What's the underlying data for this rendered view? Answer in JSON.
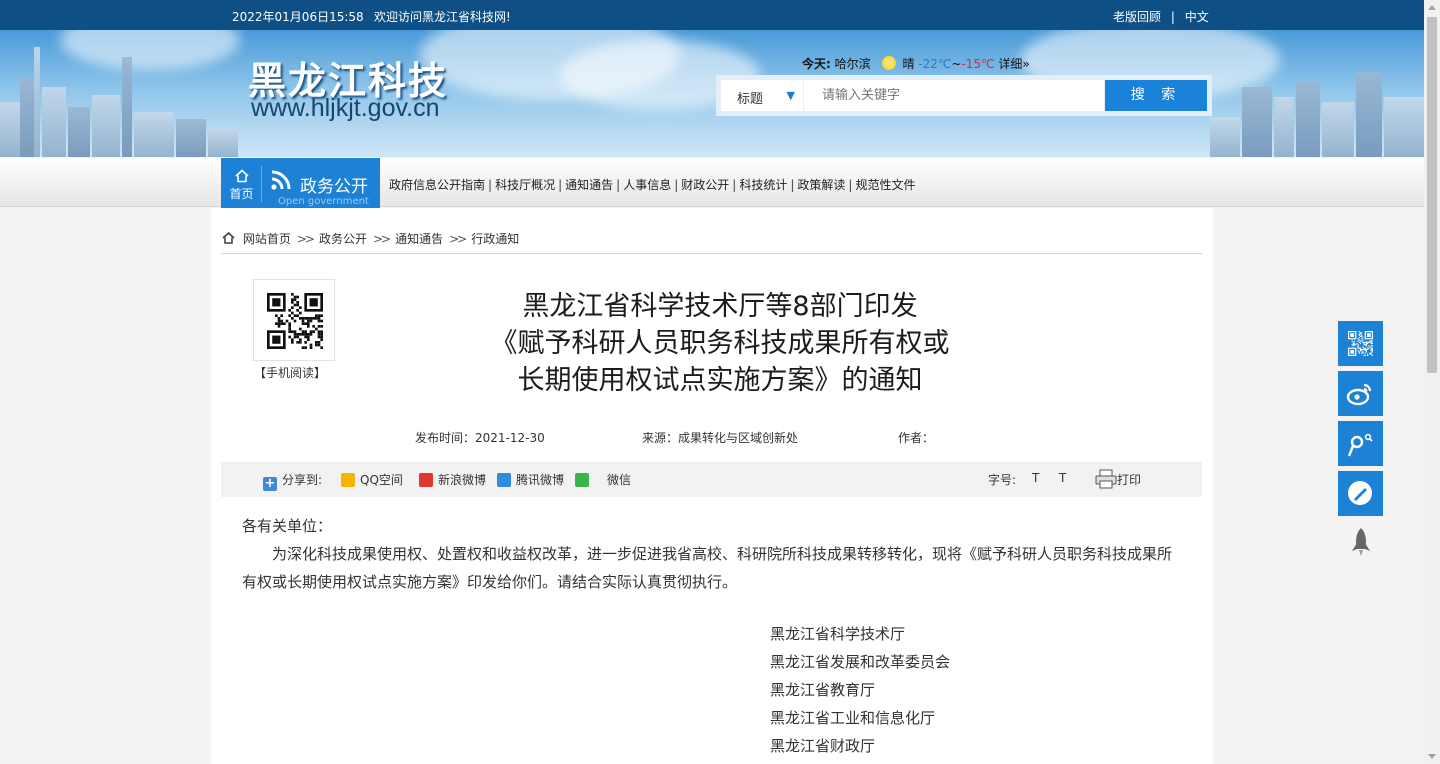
{
  "topbar": {
    "datetime": "2022年01月06日15:58",
    "welcome": "欢迎访问黑龙江省科技网!",
    "old_version": "老版回顾",
    "separator": "|",
    "language": "中文"
  },
  "header": {
    "logo_text": "黑龙江科技",
    "logo_url": "www.hljkjt.gov.cn",
    "weather": {
      "today_label": "今天:",
      "city": "哈尔滨",
      "condition": "晴",
      "low": "-22℃",
      "tilde": "~",
      "high": "-15℃",
      "detail": "详细»",
      "icon": "sun-icon"
    },
    "search": {
      "category": "标题",
      "placeholder": "请输入关键字",
      "button": "搜 索"
    }
  },
  "nav": {
    "home_label": "首页",
    "section_title": "政务公开",
    "section_subtitle": "Open government",
    "links": [
      "政府信息公开指南",
      "科技厅概况",
      "通知通告",
      "人事信息",
      "财政公开",
      "科技统计",
      "政策解读",
      "规范性文件"
    ],
    "separator": "|"
  },
  "breadcrumb": {
    "items": [
      "网站首页",
      "政务公开",
      "通知通告",
      "行政通知"
    ],
    "separator": ">>"
  },
  "article": {
    "qr_label": "【手机阅读】",
    "title_lines": [
      "黑龙江省科学技术厅等8部门印发",
      "《赋予科研人员职务科技成果所有权或",
      "长期使用权试点实施方案》的通知"
    ],
    "publish_time": "发布时间：2021-12-30",
    "source": "来源：成果转化与区域创新处",
    "author": "作者：",
    "greeting": "各有关单位：",
    "paragraph": "为深化科技成果使用权、处置权和收益权改革，进一步促进我省高校、科研院所科技成果转移转化，现将《赋予科研人员职务科技成果所有权或长期使用权试点实施方案》印发给你们。请结合实际认真贯彻执行。",
    "signers": [
      "黑龙江省科学技术厅",
      "黑龙江省发展和改革委员会",
      "黑龙江省教育厅",
      "黑龙江省工业和信息化厅",
      "黑龙江省财政厅"
    ]
  },
  "share": {
    "label": "分享到:",
    "items": [
      "QQ空间",
      "新浪微博",
      "腾讯微博",
      "微信"
    ],
    "font_label": "字号:",
    "font_small": "T",
    "font_large": "T",
    "print": "打印"
  },
  "floating": [
    "qr-code-icon",
    "weibo-icon",
    "tencent-weibo-icon",
    "edit-icon",
    "rocket-top-icon"
  ],
  "colors": {
    "primary_blue": "#1d82d6",
    "topbar": "#0e4f86",
    "temp_low": "#2a77c8",
    "temp_high": "#d62b2b"
  }
}
